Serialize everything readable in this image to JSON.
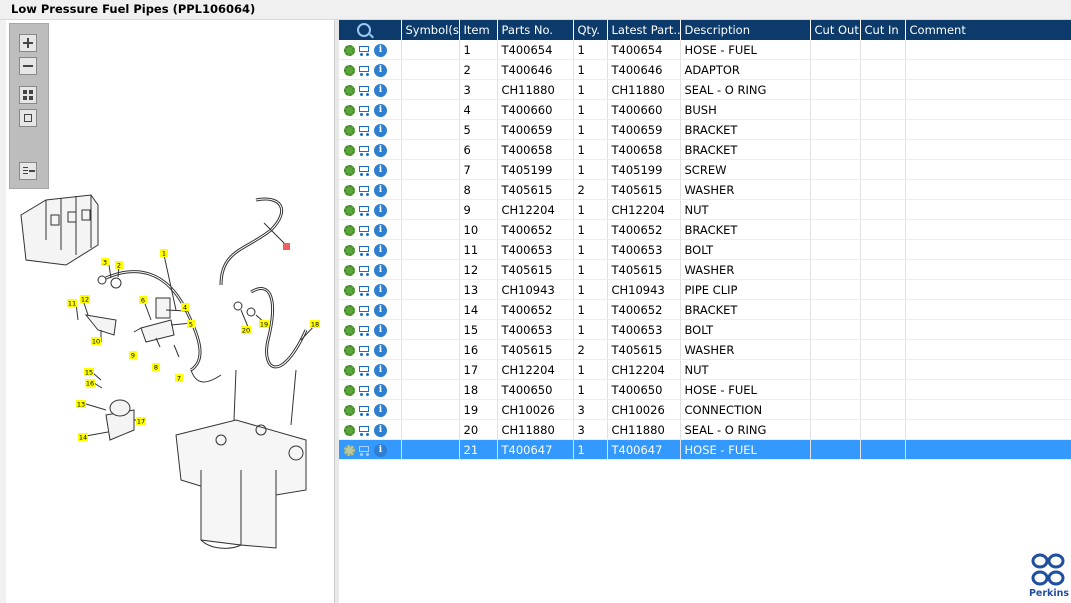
{
  "window": {
    "title": "Low Pressure Fuel Pipes (PPL106064)"
  },
  "toolbar": {
    "icons": [
      "zoom-in-icon",
      "zoom-out-icon",
      "fit-page-icon",
      "fit-window-icon",
      "expand-panel-icon"
    ]
  },
  "table": {
    "headers": {
      "symbols": "Symbol(s)",
      "item": "Item",
      "parts_no": "Parts No.",
      "qty": "Qty.",
      "latest_part": "Latest Part...",
      "description": "Description",
      "cut_out": "Cut Out",
      "cut_in": "Cut In",
      "comment": "Comment"
    },
    "rows": [
      {
        "item": "1",
        "parts_no": "T400654",
        "qty": "1",
        "latest": "T400654",
        "desc": "HOSE - FUEL"
      },
      {
        "item": "2",
        "parts_no": "T400646",
        "qty": "1",
        "latest": "T400646",
        "desc": "ADAPTOR"
      },
      {
        "item": "3",
        "parts_no": "CH11880",
        "qty": "1",
        "latest": "CH11880",
        "desc": "SEAL - O RING"
      },
      {
        "item": "4",
        "parts_no": "T400660",
        "qty": "1",
        "latest": "T400660",
        "desc": "BUSH"
      },
      {
        "item": "5",
        "parts_no": "T400659",
        "qty": "1",
        "latest": "T400659",
        "desc": "BRACKET"
      },
      {
        "item": "6",
        "parts_no": "T400658",
        "qty": "1",
        "latest": "T400658",
        "desc": "BRACKET"
      },
      {
        "item": "7",
        "parts_no": "T405199",
        "qty": "1",
        "latest": "T405199",
        "desc": "SCREW"
      },
      {
        "item": "8",
        "parts_no": "T405615",
        "qty": "2",
        "latest": "T405615",
        "desc": "WASHER"
      },
      {
        "item": "9",
        "parts_no": "CH12204",
        "qty": "1",
        "latest": "CH12204",
        "desc": "NUT"
      },
      {
        "item": "10",
        "parts_no": "T400652",
        "qty": "1",
        "latest": "T400652",
        "desc": "BRACKET"
      },
      {
        "item": "11",
        "parts_no": "T400653",
        "qty": "1",
        "latest": "T400653",
        "desc": "BOLT"
      },
      {
        "item": "12",
        "parts_no": "T405615",
        "qty": "1",
        "latest": "T405615",
        "desc": "WASHER"
      },
      {
        "item": "13",
        "parts_no": "CH10943",
        "qty": "1",
        "latest": "CH10943",
        "desc": "PIPE CLIP"
      },
      {
        "item": "14",
        "parts_no": "T400652",
        "qty": "1",
        "latest": "T400652",
        "desc": "BRACKET"
      },
      {
        "item": "15",
        "parts_no": "T400653",
        "qty": "1",
        "latest": "T400653",
        "desc": "BOLT"
      },
      {
        "item": "16",
        "parts_no": "T405615",
        "qty": "2",
        "latest": "T405615",
        "desc": "WASHER"
      },
      {
        "item": "17",
        "parts_no": "CH12204",
        "qty": "1",
        "latest": "CH12204",
        "desc": "NUT"
      },
      {
        "item": "18",
        "parts_no": "T400650",
        "qty": "1",
        "latest": "T400650",
        "desc": "HOSE - FUEL"
      },
      {
        "item": "19",
        "parts_no": "CH10026",
        "qty": "3",
        "latest": "CH10026",
        "desc": "CONNECTION"
      },
      {
        "item": "20",
        "parts_no": "CH11880",
        "qty": "3",
        "latest": "CH11880",
        "desc": "SEAL - O RING"
      },
      {
        "item": "21",
        "parts_no": "T400647",
        "qty": "1",
        "latest": "T400647",
        "desc": "HOSE - FUEL",
        "selected": true
      }
    ]
  },
  "callouts": [
    "1",
    "2",
    "3",
    "4",
    "5",
    "6",
    "7",
    "8",
    "9",
    "10",
    "11",
    "12",
    "13",
    "14",
    "15",
    "16",
    "17",
    "18",
    "19",
    "20"
  ],
  "brand": {
    "logo_text": "Perkins"
  },
  "colors": {
    "header_bg": "#0b3a6b",
    "selected_row": "#3399ff",
    "callout_bg": "#ffff00",
    "brand": "#1f4f9e"
  }
}
